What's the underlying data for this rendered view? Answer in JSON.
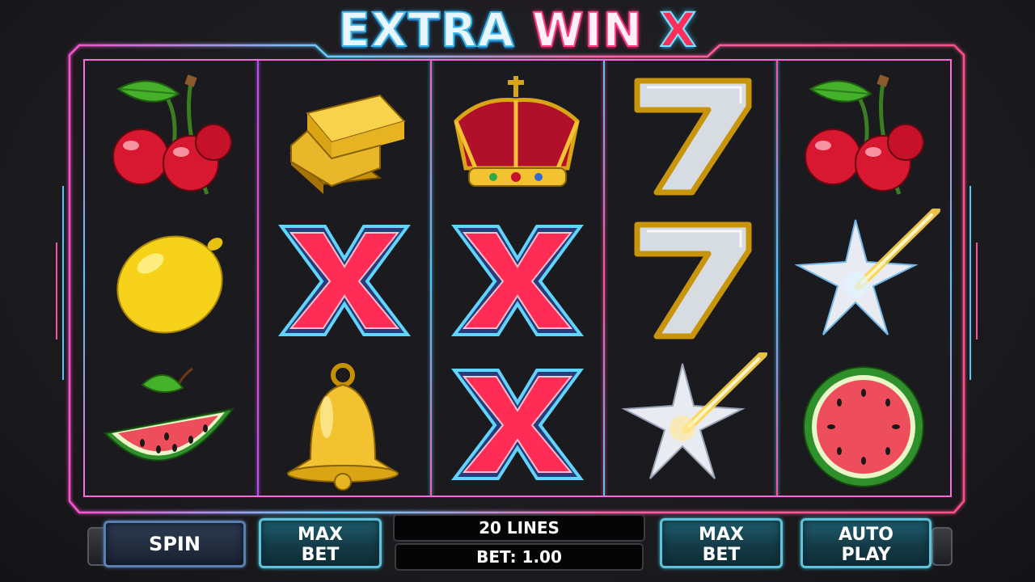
{
  "game": {
    "title_part1": "EXTRA",
    "title_part2": "WIN",
    "title_part3": "X"
  },
  "reels": [
    [
      "cherry-icon",
      "lemon-icon",
      "watermelon-slice-icon"
    ],
    [
      "gold-bars-icon",
      "x-symbol-icon",
      "bell-icon"
    ],
    [
      "crown-icon",
      "x-symbol-icon",
      "x-symbol-icon"
    ],
    [
      "seven-icon",
      "seven-icon",
      "star-burst-icon"
    ],
    [
      "cherry-icon",
      "star-burst-icon",
      "watermelon-icon"
    ]
  ],
  "controls": {
    "spin_label": "SPIN",
    "max_bet_left_line1": "MAX",
    "max_bet_left_line2": "BET",
    "lines_label": "20 LINES",
    "bet_label": "BET: 1.00",
    "max_bet_right_line1": "MAX",
    "max_bet_right_line2": "BET",
    "auto_play_line1": "AUTO",
    "auto_play_line2": "PLAY"
  },
  "colors": {
    "frame_cyan": "#38c8ff",
    "frame_pink": "#ff4fa0",
    "frame_purple": "#b04cff",
    "x_symbol_red": "#ff2d55",
    "button_teal": "#1f5f70"
  }
}
